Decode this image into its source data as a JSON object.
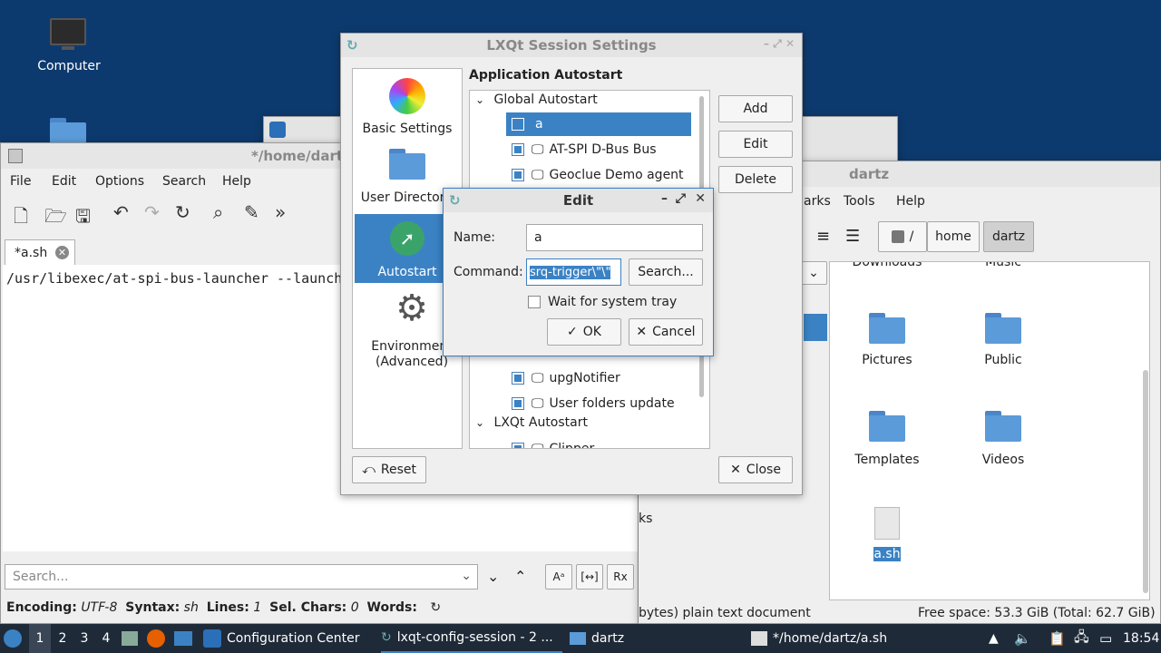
{
  "desktop": {
    "computer_label": "Computer"
  },
  "editor": {
    "title": "*/home/dartz/a.sh",
    "menu": [
      "File",
      "Edit",
      "Options",
      "Search",
      "Help"
    ],
    "tab_label": "*a.sh",
    "code_line": "/usr/libexec/at-spi-bus-launcher --launch",
    "search_placeholder": "Search...",
    "status": {
      "encoding_label": "Encoding:",
      "encoding": "UTF-8",
      "syntax_label": "Syntax:",
      "syntax": "sh",
      "lines_label": "Lines:",
      "lines": "1",
      "sel_label": "Sel. Chars:",
      "sel": "0",
      "words_label": "Words:"
    },
    "tail_text": "ks",
    "status_tail": "bytes) plain text document"
  },
  "filemanager": {
    "title": "dartz",
    "menu": [
      "arks",
      "Tools",
      "Help"
    ],
    "path": [
      "/",
      "home",
      "dartz"
    ],
    "items": [
      {
        "label": "Downloads"
      },
      {
        "label": "Music"
      },
      {
        "label": "Pictures"
      },
      {
        "label": "Public"
      },
      {
        "label": "Templates"
      },
      {
        "label": "Videos"
      },
      {
        "label": "a.sh"
      }
    ],
    "free_space": "Free space: 53.3 GiB (Total: 62.7 GiB)"
  },
  "session": {
    "title": "LXQt Session Settings",
    "sidebar": [
      "Basic Settings",
      "User Directories",
      "Autostart",
      "Environment (Advanced)"
    ],
    "section_title": "Application Autostart",
    "global_group": "Global Autostart",
    "lxqt_group": "LXQt Autostart",
    "entries": [
      {
        "label": "a",
        "checked": false,
        "selected": true
      },
      {
        "label": "AT-SPI D-Bus Bus",
        "checked": true
      },
      {
        "label": "Geoclue Demo agent",
        "checked": true
      },
      {
        "label": "upgNotifier",
        "checked": true
      },
      {
        "label": "User folders update",
        "checked": true
      },
      {
        "label": "Clipper",
        "checked": true
      }
    ],
    "buttons": {
      "add": "Add",
      "edit": "Edit",
      "delete": "Delete",
      "reset": "Reset",
      "close": "Close"
    }
  },
  "dialog": {
    "title": "Edit",
    "name_label": "Name:",
    "name_value": "a",
    "command_label": "Command:",
    "command_value": "srq-trigger\\\"\\\"",
    "search_button": "Search...",
    "wait_label": "Wait for system tray",
    "ok": "OK",
    "cancel": "Cancel"
  },
  "taskbar": {
    "desktops": [
      "1",
      "2",
      "3",
      "4"
    ],
    "tasks": [
      "Configuration Center",
      "lxqt-config-session - 2 ...",
      "dartz",
      "*/home/dartz/a.sh"
    ],
    "clock": "18:54"
  }
}
